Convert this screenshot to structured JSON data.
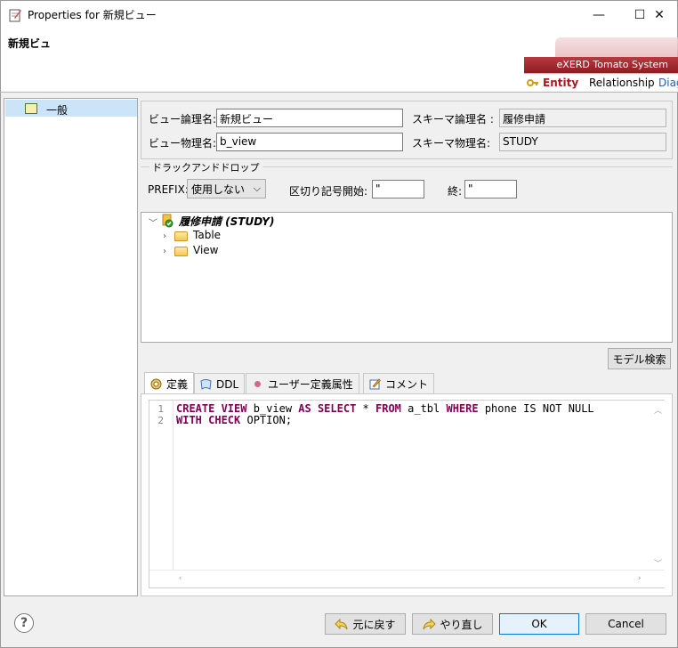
{
  "window": {
    "title": "Properties for 新規ビュー",
    "minimize": "—",
    "maximize": "☐",
    "close": "✕"
  },
  "header": {
    "title": "新規ビュ",
    "banner_brand": "eXERD  Tomato System",
    "banner_tabs": [
      "Entity",
      "Relationship",
      "Diag"
    ]
  },
  "left_tree": {
    "items": [
      {
        "label": "一般"
      }
    ]
  },
  "form": {
    "view_logical_label": "ビュー論理名:",
    "view_logical_value": "新規ビュー",
    "view_physical_label": "ビュー物理名:",
    "view_physical_value": "b_view",
    "schema_logical_label": "スキーマ論理名 :",
    "schema_logical_value": "履修申請",
    "schema_physical_label": "スキーマ物理名:",
    "schema_physical_value": "STUDY"
  },
  "dnd": {
    "legend": "ドラックアンドドロップ",
    "prefix_label": "PREFIX:",
    "prefix_value": "使用しない",
    "delim_start_label": "区切り記号開始:",
    "delim_start_value": "\"",
    "delim_end_label": "終:",
    "delim_end_value": "\""
  },
  "schema_tree": {
    "root": "履修申請 (STUDY)",
    "children": [
      "Table",
      "View"
    ]
  },
  "model_search_label": "モデル検索",
  "tabs": [
    "定義",
    "DDL",
    "ユーザー定義属性",
    "コメント"
  ],
  "editor": {
    "line_numbers": [
      "1",
      "2"
    ],
    "line1": [
      {
        "t": "CREATE VIEW",
        "k": true
      },
      {
        "t": " b_view ",
        "k": false
      },
      {
        "t": "AS SELECT",
        "k": true
      },
      {
        "t": " * ",
        "k": false
      },
      {
        "t": "FROM",
        "k": true
      },
      {
        "t": " a_tbl ",
        "k": false
      },
      {
        "t": "WHERE",
        "k": true
      },
      {
        "t": " phone IS NOT NULL",
        "k": false
      }
    ],
    "line2": [
      {
        "t": "WITH CHECK",
        "k": true
      },
      {
        "t": " OPTION;",
        "k": false
      }
    ]
  },
  "buttons": {
    "undo": "元に戻す",
    "redo": "やり直し",
    "ok": "OK",
    "cancel": "Cancel",
    "help": "?"
  },
  "colors": {
    "keyword": "#7f0055",
    "selection": "#cce4f7",
    "banner": "#9e262c"
  }
}
